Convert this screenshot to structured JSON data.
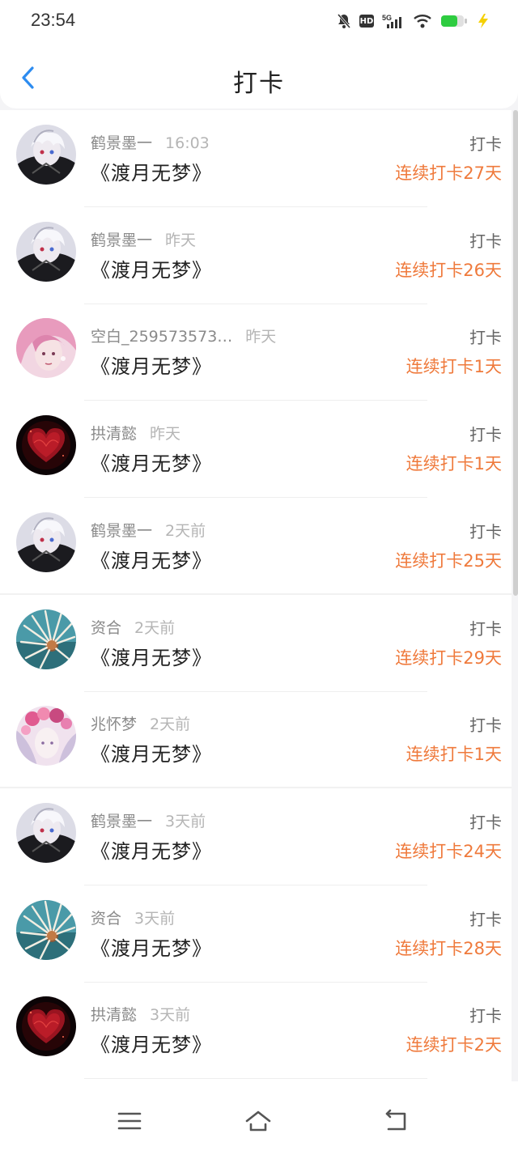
{
  "status": {
    "time": "23:54",
    "hd": "HD",
    "network": "5G"
  },
  "header": {
    "title": "打卡"
  },
  "items": [
    {
      "user": "鹤景墨一",
      "time": "16:03",
      "title": "《渡月无梦》",
      "action": "打卡",
      "streak": "连续打卡27天",
      "avatar": "avatar-anime-white-hair"
    },
    {
      "user": "鹤景墨一",
      "time": "昨天",
      "title": "《渡月无梦》",
      "action": "打卡",
      "streak": "连续打卡26天",
      "avatar": "avatar-anime-white-hair"
    },
    {
      "user": "空白_259573573…",
      "time": "昨天",
      "title": "《渡月无梦》",
      "action": "打卡",
      "streak": "连续打卡1天",
      "avatar": "avatar-pink-hair-girl"
    },
    {
      "user": "拱清懿",
      "time": "昨天",
      "title": "《渡月无梦》",
      "action": "打卡",
      "streak": "连续打卡1天",
      "avatar": "avatar-red-heart"
    },
    {
      "user": "鹤景墨一",
      "time": "2天前",
      "title": "《渡月无梦》",
      "action": "打卡",
      "streak": "连续打卡25天",
      "avatar": "avatar-anime-white-hair"
    },
    {
      "user": "资合",
      "time": "2天前",
      "title": "《渡月无梦》",
      "action": "打卡",
      "streak": "连续打卡29天",
      "avatar": "avatar-sea-creature"
    },
    {
      "user": "兆怀梦",
      "time": "2天前",
      "title": "《渡月无梦》",
      "action": "打卡",
      "streak": "连续打卡1天",
      "avatar": "avatar-flower-girl"
    },
    {
      "user": "鹤景墨一",
      "time": "3天前",
      "title": "《渡月无梦》",
      "action": "打卡",
      "streak": "连续打卡24天",
      "avatar": "avatar-anime-white-hair"
    },
    {
      "user": "资合",
      "time": "3天前",
      "title": "《渡月无梦》",
      "action": "打卡",
      "streak": "连续打卡28天",
      "avatar": "avatar-sea-creature"
    },
    {
      "user": "拱清懿",
      "time": "3天前",
      "title": "《渡月无梦》",
      "action": "打卡",
      "streak": "连续打卡2天",
      "avatar": "avatar-red-heart"
    }
  ],
  "colors": {
    "accent": "#2d8cf0",
    "streak": "#ef7a3c",
    "background": "#f4f4f6"
  },
  "navbar": {
    "icons": [
      "menu-icon",
      "home-icon",
      "back-nav-icon"
    ]
  }
}
